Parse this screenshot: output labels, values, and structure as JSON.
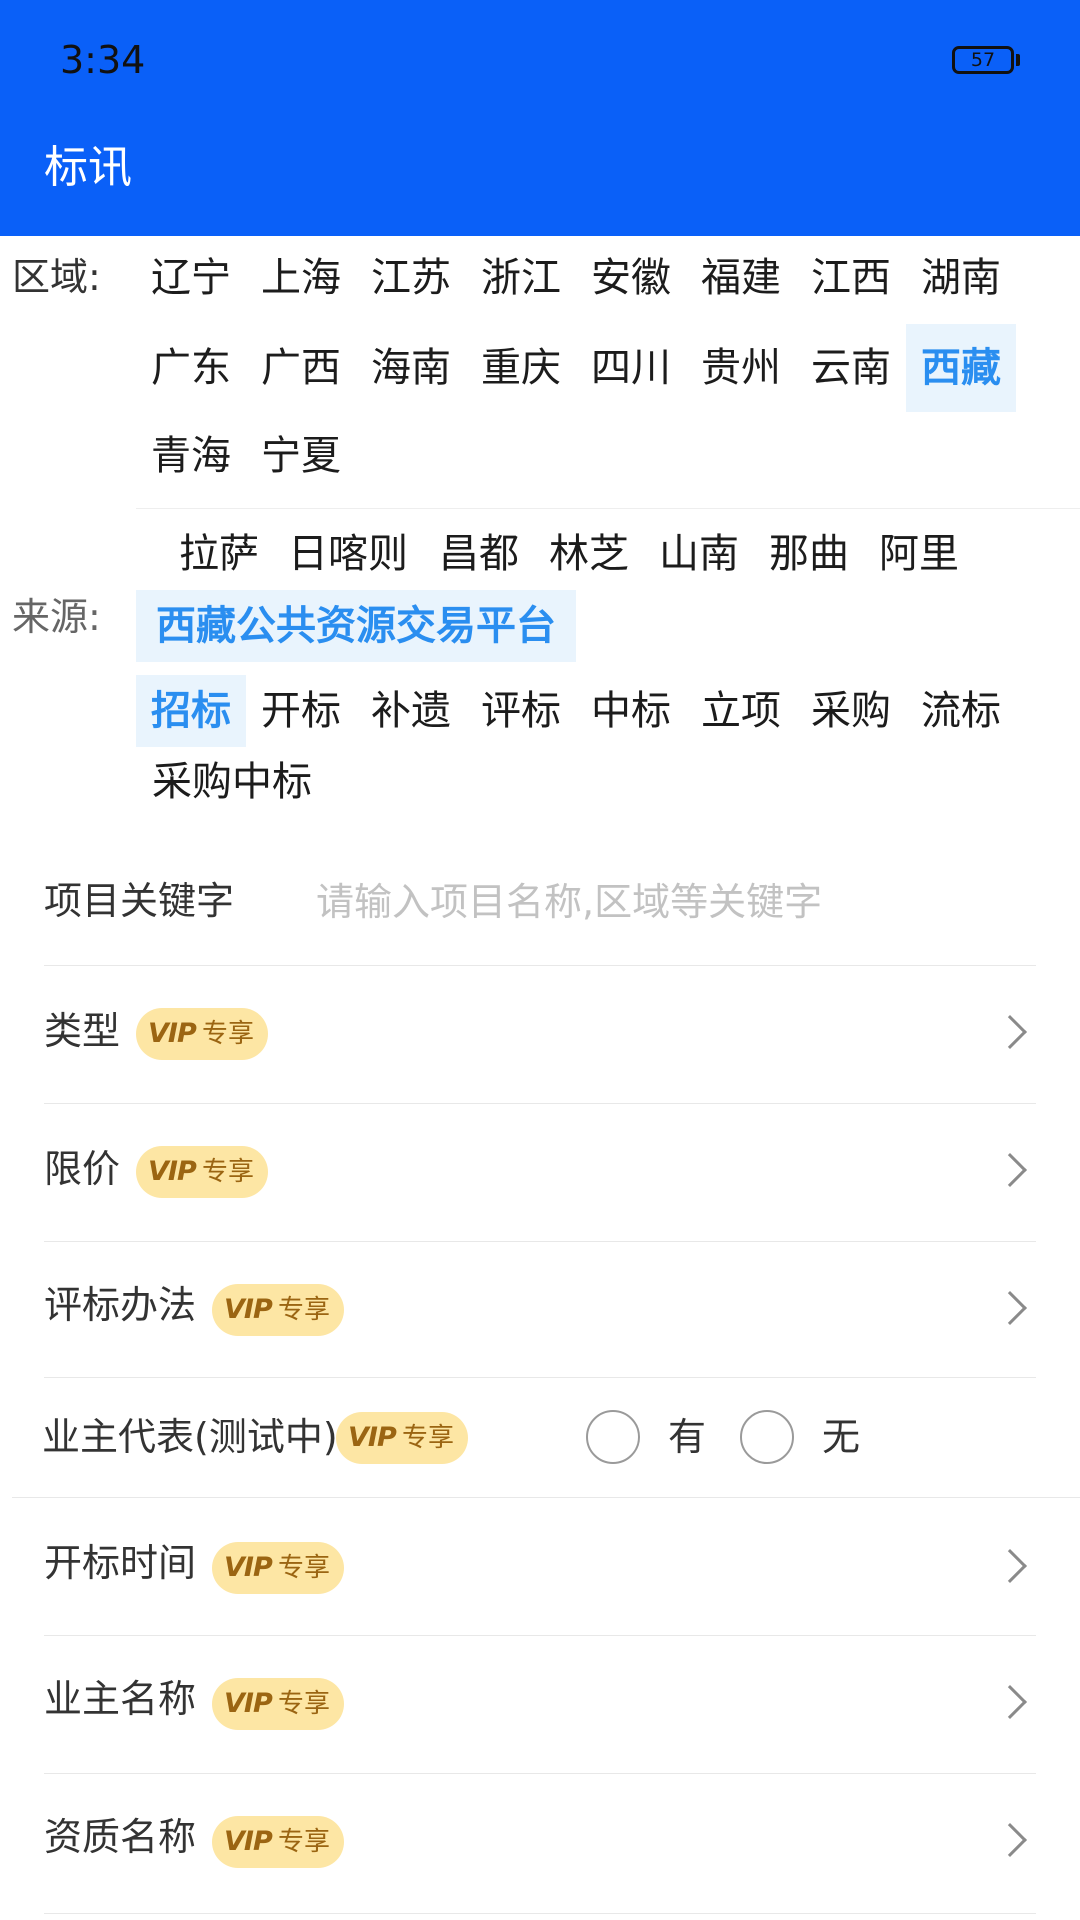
{
  "status_bar": {
    "time": "3:34",
    "battery": "57"
  },
  "header": {
    "title": "标讯"
  },
  "region": {
    "label": "区域:",
    "items": [
      "辽宁",
      "上海",
      "江苏",
      "浙江",
      "安徽",
      "福建",
      "江西",
      "湖南",
      "广东",
      "广西",
      "海南",
      "重庆",
      "四川",
      "贵州",
      "云南",
      "西藏",
      "青海",
      "宁夏"
    ],
    "selected": "西藏"
  },
  "cities": {
    "items": [
      "拉萨",
      "日喀则",
      "昌都",
      "林芝",
      "山南",
      "那曲",
      "阿里"
    ]
  },
  "source": {
    "label": "来源:",
    "platform": "西藏公共资源交易平台",
    "types": [
      "招标",
      "开标",
      "补遗",
      "评标",
      "中标",
      "立项",
      "采购",
      "流标",
      "采购中标"
    ],
    "selected_type": "招标"
  },
  "form": {
    "keyword_label": "项目关键字",
    "keyword_value": "",
    "keyword_placeholder": "请输入项目名称,区域等关键字",
    "vip_text": "VIP",
    "vip_exclusive": "专享",
    "rows": {
      "type": "类型",
      "price_limit": "限价",
      "eval_method": "评标办法",
      "owner_rep": "业主代表(测试中)",
      "open_time": "开标时间",
      "owner_name": "业主名称",
      "qualification": "资质名称"
    },
    "owner_rep_options": [
      "有",
      "无"
    ]
  },
  "colors": {
    "header_bg": "#0a60f8",
    "accent": "#2a8ef0",
    "chip_active_bg": "#e9f4fd",
    "vip_bg": "#fde6a4",
    "vip_text": "#9b6512"
  }
}
